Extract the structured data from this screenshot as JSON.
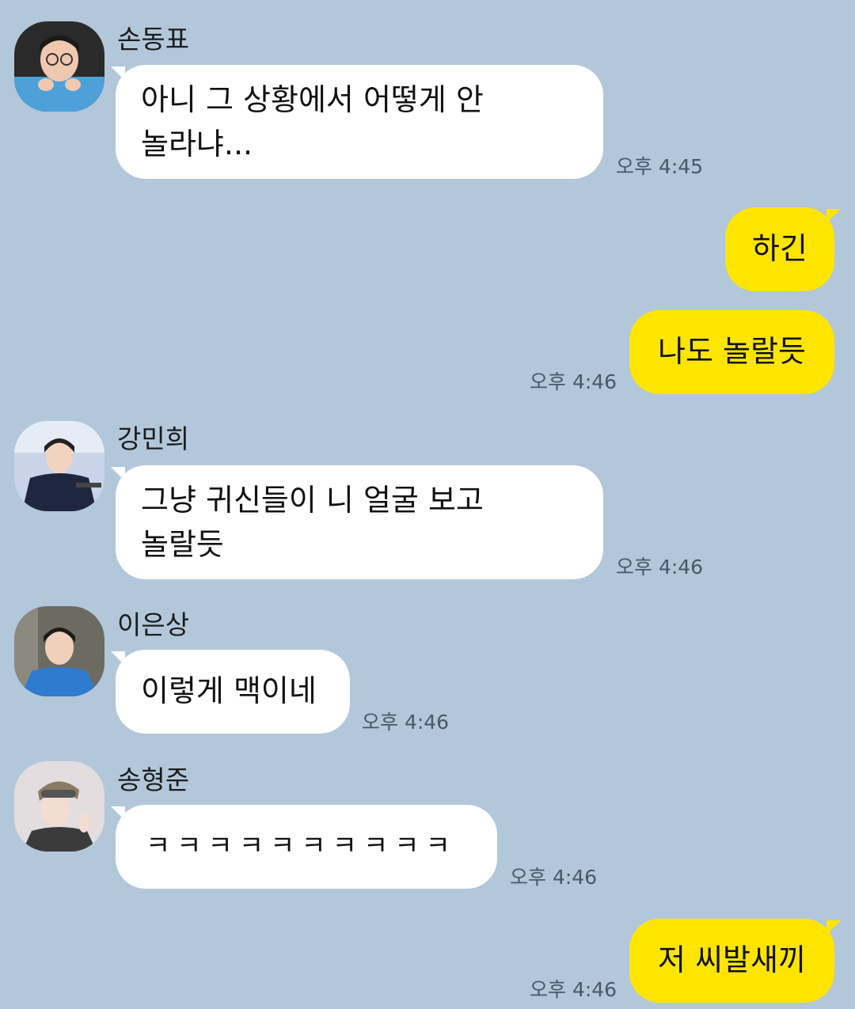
{
  "messages": [
    {
      "sender": "손동표",
      "lines": [
        "아니 그 상황에서 어떻게 안",
        "놀라냐..."
      ],
      "time": "오후 4:45"
    },
    {
      "lines": [
        "하긴"
      ]
    },
    {
      "lines": [
        "나도 놀랄듯"
      ],
      "time": "오후 4:46"
    },
    {
      "sender": "강민희",
      "lines": [
        "그냥 귀신들이 니 얼굴 보고",
        "놀랄듯"
      ],
      "time": "오후 4:46"
    },
    {
      "sender": "이은상",
      "lines": [
        "이렇게 맥이네"
      ],
      "time": "오후 4:46"
    },
    {
      "sender": "송형준",
      "lines": [
        "ㅋㅋㅋㅋㅋㅋㅋㅋㅋㅋ"
      ],
      "time": "오후 4:46"
    },
    {
      "lines": [
        "저 씨발새끼"
      ],
      "time": "오후 4:46"
    }
  ],
  "colors": {
    "background": "#b2c7da",
    "incoming_bubble": "#ffffff",
    "outgoing_bubble": "#fee500"
  },
  "avatars": [
    "profile-photo-sondongpyo",
    "profile-photo-kangminhee",
    "profile-photo-leeeunsang",
    "profile-photo-songhyeongjun"
  ]
}
